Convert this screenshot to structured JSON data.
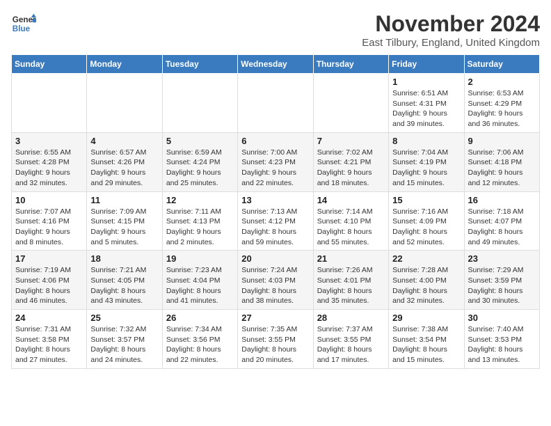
{
  "header": {
    "logo_line1": "General",
    "logo_line2": "Blue",
    "month": "November 2024",
    "location": "East Tilbury, England, United Kingdom"
  },
  "days_of_week": [
    "Sunday",
    "Monday",
    "Tuesday",
    "Wednesday",
    "Thursday",
    "Friday",
    "Saturday"
  ],
  "weeks": [
    [
      {
        "day": "",
        "details": ""
      },
      {
        "day": "",
        "details": ""
      },
      {
        "day": "",
        "details": ""
      },
      {
        "day": "",
        "details": ""
      },
      {
        "day": "",
        "details": ""
      },
      {
        "day": "1",
        "details": "Sunrise: 6:51 AM\nSunset: 4:31 PM\nDaylight: 9 hours and 39 minutes."
      },
      {
        "day": "2",
        "details": "Sunrise: 6:53 AM\nSunset: 4:29 PM\nDaylight: 9 hours and 36 minutes."
      }
    ],
    [
      {
        "day": "3",
        "details": "Sunrise: 6:55 AM\nSunset: 4:28 PM\nDaylight: 9 hours and 32 minutes."
      },
      {
        "day": "4",
        "details": "Sunrise: 6:57 AM\nSunset: 4:26 PM\nDaylight: 9 hours and 29 minutes."
      },
      {
        "day": "5",
        "details": "Sunrise: 6:59 AM\nSunset: 4:24 PM\nDaylight: 9 hours and 25 minutes."
      },
      {
        "day": "6",
        "details": "Sunrise: 7:00 AM\nSunset: 4:23 PM\nDaylight: 9 hours and 22 minutes."
      },
      {
        "day": "7",
        "details": "Sunrise: 7:02 AM\nSunset: 4:21 PM\nDaylight: 9 hours and 18 minutes."
      },
      {
        "day": "8",
        "details": "Sunrise: 7:04 AM\nSunset: 4:19 PM\nDaylight: 9 hours and 15 minutes."
      },
      {
        "day": "9",
        "details": "Sunrise: 7:06 AM\nSunset: 4:18 PM\nDaylight: 9 hours and 12 minutes."
      }
    ],
    [
      {
        "day": "10",
        "details": "Sunrise: 7:07 AM\nSunset: 4:16 PM\nDaylight: 9 hours and 8 minutes."
      },
      {
        "day": "11",
        "details": "Sunrise: 7:09 AM\nSunset: 4:15 PM\nDaylight: 9 hours and 5 minutes."
      },
      {
        "day": "12",
        "details": "Sunrise: 7:11 AM\nSunset: 4:13 PM\nDaylight: 9 hours and 2 minutes."
      },
      {
        "day": "13",
        "details": "Sunrise: 7:13 AM\nSunset: 4:12 PM\nDaylight: 8 hours and 59 minutes."
      },
      {
        "day": "14",
        "details": "Sunrise: 7:14 AM\nSunset: 4:10 PM\nDaylight: 8 hours and 55 minutes."
      },
      {
        "day": "15",
        "details": "Sunrise: 7:16 AM\nSunset: 4:09 PM\nDaylight: 8 hours and 52 minutes."
      },
      {
        "day": "16",
        "details": "Sunrise: 7:18 AM\nSunset: 4:07 PM\nDaylight: 8 hours and 49 minutes."
      }
    ],
    [
      {
        "day": "17",
        "details": "Sunrise: 7:19 AM\nSunset: 4:06 PM\nDaylight: 8 hours and 46 minutes."
      },
      {
        "day": "18",
        "details": "Sunrise: 7:21 AM\nSunset: 4:05 PM\nDaylight: 8 hours and 43 minutes."
      },
      {
        "day": "19",
        "details": "Sunrise: 7:23 AM\nSunset: 4:04 PM\nDaylight: 8 hours and 41 minutes."
      },
      {
        "day": "20",
        "details": "Sunrise: 7:24 AM\nSunset: 4:03 PM\nDaylight: 8 hours and 38 minutes."
      },
      {
        "day": "21",
        "details": "Sunrise: 7:26 AM\nSunset: 4:01 PM\nDaylight: 8 hours and 35 minutes."
      },
      {
        "day": "22",
        "details": "Sunrise: 7:28 AM\nSunset: 4:00 PM\nDaylight: 8 hours and 32 minutes."
      },
      {
        "day": "23",
        "details": "Sunrise: 7:29 AM\nSunset: 3:59 PM\nDaylight: 8 hours and 30 minutes."
      }
    ],
    [
      {
        "day": "24",
        "details": "Sunrise: 7:31 AM\nSunset: 3:58 PM\nDaylight: 8 hours and 27 minutes."
      },
      {
        "day": "25",
        "details": "Sunrise: 7:32 AM\nSunset: 3:57 PM\nDaylight: 8 hours and 24 minutes."
      },
      {
        "day": "26",
        "details": "Sunrise: 7:34 AM\nSunset: 3:56 PM\nDaylight: 8 hours and 22 minutes."
      },
      {
        "day": "27",
        "details": "Sunrise: 7:35 AM\nSunset: 3:55 PM\nDaylight: 8 hours and 20 minutes."
      },
      {
        "day": "28",
        "details": "Sunrise: 7:37 AM\nSunset: 3:55 PM\nDaylight: 8 hours and 17 minutes."
      },
      {
        "day": "29",
        "details": "Sunrise: 7:38 AM\nSunset: 3:54 PM\nDaylight: 8 hours and 15 minutes."
      },
      {
        "day": "30",
        "details": "Sunrise: 7:40 AM\nSunset: 3:53 PM\nDaylight: 8 hours and 13 minutes."
      }
    ]
  ]
}
